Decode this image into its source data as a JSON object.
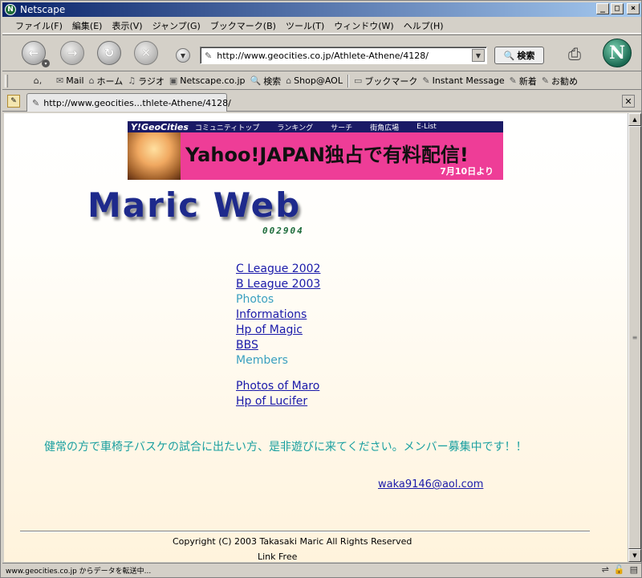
{
  "window": {
    "title": "Netscape",
    "app_icon": "N",
    "controls": [
      "minimize-icon",
      "maximize-icon",
      "close-icon"
    ]
  },
  "menu": [
    "ファイル(F)",
    "編集(E)",
    "表示(V)",
    "ジャンプ(G)",
    "ブックマーク(B)",
    "ツール(T)",
    "ウィンドウ(W)",
    "ヘルプ(H)"
  ],
  "nav": {
    "url": "http://www.geocities.co.jp/Athlete-Athene/4128/",
    "search_label": "検索",
    "logo_letter": "N"
  },
  "personal_toolbar": {
    "items": [
      "Mail",
      "ホーム",
      "ラジオ",
      "Netscape.co.jp",
      "検索",
      "Shop@AOL",
      "ブックマーク",
      "Instant Message",
      "新着",
      "お勧め"
    ]
  },
  "tab": {
    "title": "http://www.geocities...thlete-Athene/4128/"
  },
  "banner": {
    "brand": "Y!GeoCities",
    "nav": [
      "コミュニティトップ",
      "ランキング",
      "サーチ",
      "街角広場",
      "E-List"
    ],
    "headline": "Yahoo!JAPAN独占で有料配信!",
    "date": "7月10日より"
  },
  "page": {
    "site_title": "Maric Web",
    "counter": "002904",
    "links": [
      {
        "label": "C League 2002",
        "link": true
      },
      {
        "label": "B League 2003",
        "link": true
      },
      {
        "label": "Photos",
        "link": false
      },
      {
        "label": "Informations",
        "link": true
      },
      {
        "label": "Hp of Magic",
        "link": true
      },
      {
        "label": "BBS",
        "link": true
      },
      {
        "label": "Members",
        "link": false
      }
    ],
    "links2": [
      {
        "label": "Photos of Maro",
        "link": true
      },
      {
        "label": "Hp of Lucifer",
        "link": true
      }
    ],
    "message": "健常の方で車椅子バスケの試合に出たい方、是非遊びに来てください。メンバー募集中です！！",
    "email": "waka9146@aol.com",
    "copyright": "Copyright (C) 2003 Takasaki Maric All Rights Reserved",
    "link_free": "Link Free"
  },
  "status": {
    "text": "www.geocities.co.jp からデータを転送中..."
  }
}
